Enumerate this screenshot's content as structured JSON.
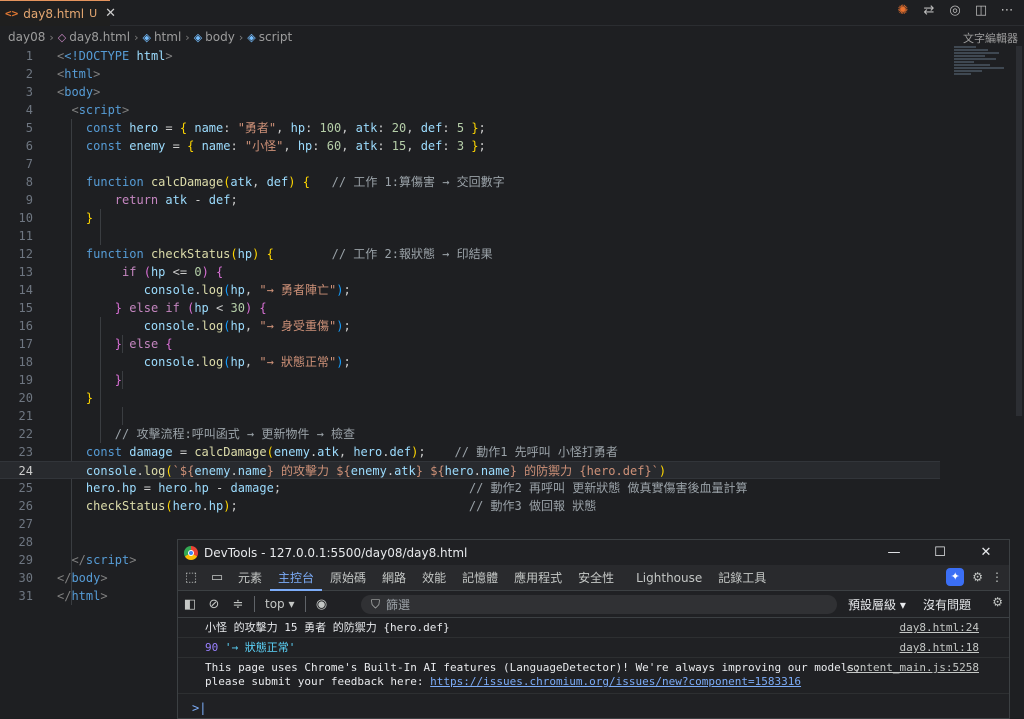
{
  "editor": {
    "tab": {
      "icon": "<>",
      "filename": "day8.html",
      "status": "U"
    },
    "breadcrumb": [
      "day08",
      "day8.html",
      "html",
      "body",
      "script"
    ],
    "minimap_label": "文字編輯器",
    "lines": [
      {
        "n": "1"
      },
      {
        "n": "2"
      },
      {
        "n": "3"
      },
      {
        "n": "4"
      },
      {
        "n": "5"
      },
      {
        "n": "6"
      },
      {
        "n": "7"
      },
      {
        "n": "8"
      },
      {
        "n": "9"
      },
      {
        "n": "10"
      },
      {
        "n": "11"
      },
      {
        "n": "12"
      },
      {
        "n": "13"
      },
      {
        "n": "14"
      },
      {
        "n": "15"
      },
      {
        "n": "16"
      },
      {
        "n": "17"
      },
      {
        "n": "18"
      },
      {
        "n": "19"
      },
      {
        "n": "20"
      },
      {
        "n": "21"
      },
      {
        "n": "22"
      },
      {
        "n": "23"
      },
      {
        "n": "24"
      },
      {
        "n": "25"
      },
      {
        "n": "26"
      },
      {
        "n": "27"
      },
      {
        "n": "28"
      },
      {
        "n": "29"
      },
      {
        "n": "30"
      },
      {
        "n": "31"
      }
    ],
    "code": {
      "l1a": "<!DOCTYPE",
      "l1b": " html",
      "l1c": ">",
      "l2": "html",
      "l3": "body",
      "l4": "script",
      "const": "const",
      "function": "function",
      "return": "return",
      "if": "if",
      "else": "else",
      "hero": "hero",
      "enemy": "enemy",
      "name": "name",
      "hp": "hp",
      "atk": "atk",
      "def": "def",
      "hero_name": "\"勇者\"",
      "hero_hp": "100",
      "hero_atk": "20",
      "hero_def": "5",
      "enemy_name": "\"小怪\"",
      "enemy_hp": "60",
      "enemy_atk": "15",
      "enemy_def": "3",
      "calcDamage": "calcDamage",
      "checkStatus": "checkStatus",
      "cm8": "// 工作 1:算傷害 → 交回數字",
      "cm12": "// 工作 2:報狀態 → 印結果",
      "zero": "0",
      "thirty": "30",
      "console": "console",
      "log": "log",
      "s14": "\"→ 勇者陣亡\"",
      "s16": "\"→ 身受重傷\"",
      "s18": "\"→ 狀態正常\"",
      "cm22": "// 攻擊流程:呼叫函式 → 更新物件 → 檢查",
      "damage": "damage",
      "cm23": "// 動作1 先呼叫 小怪打勇者",
      "tpl24a": "`${",
      "tpl24b": "} 的攻擊力 ${",
      "tpl24c": "} ${",
      "tpl24d": "} 的防禦力 {hero.def}`",
      "cm25": "// 動作2 再呼叫 更新狀態 做真實傷害後血量計算",
      "cm26": "// 動作3 做回報 狀態"
    }
  },
  "devtools": {
    "title": "DevTools - 127.0.0.1:5500/day08/day8.html",
    "window_buttons": [
      "—",
      "☐",
      "✕"
    ],
    "tabs": [
      "元素",
      "主控台",
      "原始碼",
      "網路",
      "效能",
      "記憶體",
      "應用程式",
      "安全性",
      "Lighthouse",
      "記錄工具"
    ],
    "active_tab": "主控台",
    "context": "top ▾",
    "filter_placeholder": "篩選",
    "levels": "預設層級 ▾",
    "issues": "沒有問題",
    "messages": [
      {
        "text": "小怪 的攻擊力 15 勇者 的防禦力 {hero.def}",
        "source": "day8.html:24"
      },
      {
        "num": "90",
        "str": "'→ 狀態正常'",
        "source": "day8.html:18"
      },
      {
        "line1": "This page uses Chrome's Built-In AI features (LanguageDetector)! We're always improving our models;",
        "line2_prefix": "please submit your feedback here: ",
        "link": "https://issues.chromium.org/issues/new?component=1583316",
        "source": "content_main.js:5258"
      }
    ],
    "prompt": ">|"
  }
}
